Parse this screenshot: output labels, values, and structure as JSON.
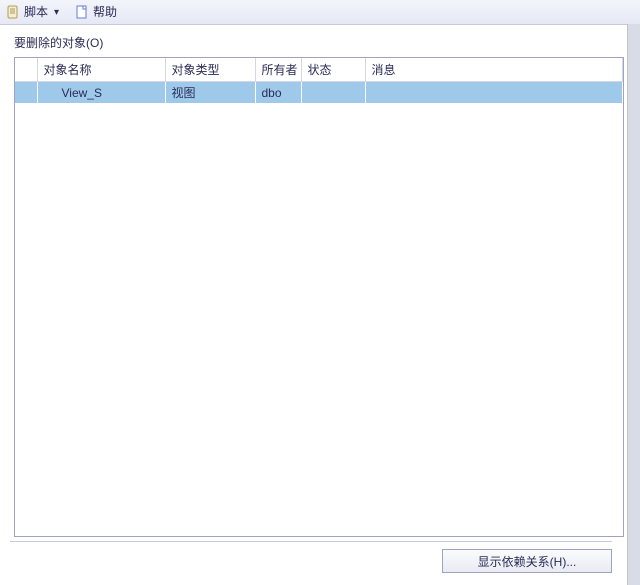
{
  "toolbar": {
    "script_label": "脚本",
    "help_label": "帮助",
    "icons": {
      "script": "scroll-icon",
      "help": "page-icon"
    }
  },
  "section_title": "要删除的对象(O)",
  "columns": {
    "name": "对象名称",
    "type": "对象类型",
    "owner": "所有者",
    "state": "状态",
    "message": "消息"
  },
  "rows": [
    {
      "name": "View_S",
      "type": "视图",
      "owner": "dbo",
      "state": "",
      "message": ""
    }
  ],
  "footer": {
    "show_dependencies_label": "显示依赖关系(H)..."
  }
}
